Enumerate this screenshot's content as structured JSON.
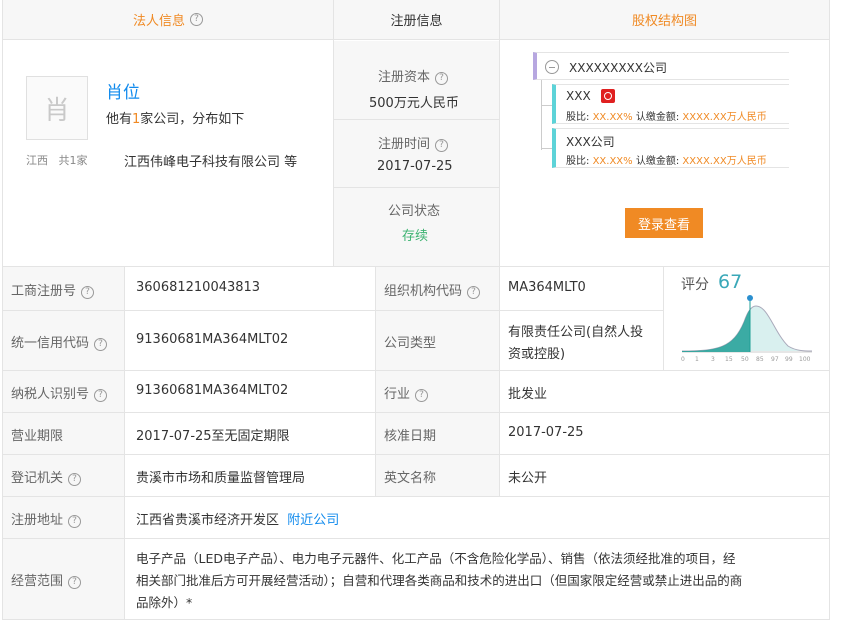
{
  "headers": {
    "legal": "法人信息",
    "reg": "注册信息",
    "equity": "股权结构图"
  },
  "person": {
    "avatar_char": "肖",
    "name": "肖位",
    "companies_prefix": "他有",
    "companies_count": "1",
    "companies_suffix": "家公司，分布如下",
    "region": "江西",
    "region_count": "共1家",
    "company": "江西伟峰电子科技有限公司 等"
  },
  "reg": {
    "capital_label": "注册资本",
    "capital_value": "500万元人民币",
    "date_label": "注册时间",
    "date_value": "2017-07-25",
    "status_label": "公司状态",
    "status_value": "存续"
  },
  "equity": {
    "root": "XXXXXXXXX公司",
    "nodes": [
      {
        "name": "XXX",
        "ratio_label": "股比:",
        "ratio": "XX.XX%",
        "sub_label": "认缴金额:",
        "sub": "XXXX.XX万人民币"
      },
      {
        "name": "XXX公司",
        "ratio_label": "股比:",
        "ratio": "XX.XX%",
        "sub_label": "认缴金额:",
        "sub": "XXXX.XX万人民币"
      }
    ],
    "login_button": "登录查看"
  },
  "score": {
    "label": "评分",
    "value": "67",
    "ticks": [
      "0",
      "1",
      "3",
      "15",
      "50",
      "85",
      "97",
      "99",
      "100"
    ]
  },
  "rows": [
    {
      "label1": "工商注册号",
      "value1": "360681210043813",
      "label2": "组织机构代码",
      "value2": "MA364MLT0"
    },
    {
      "label1": "统一信用代码",
      "value1": "91360681MA364MLT02",
      "label2": "公司类型",
      "value2_line1": "有限责任公司(自然人投",
      "value2_line2": "资或控股)"
    },
    {
      "label1": "纳税人识别号",
      "value1": "91360681MA364MLT02",
      "label2": "行业",
      "value2": "批发业"
    },
    {
      "label1": "营业期限",
      "value1": "2017-07-25至无固定期限",
      "label2": "核准日期",
      "value2": "2017-07-25"
    },
    {
      "label1": "登记机关",
      "value1": "贵溪市市场和质量监督管理局",
      "label2": "英文名称",
      "value2": "未公开"
    },
    {
      "label1": "注册地址",
      "value1": "江西省贵溪市经济开发区",
      "link": "附近公司"
    },
    {
      "label1": "经营范围",
      "line1": "电子产品（LED电子产品）、电力电子元器件、化工产品（不含危险化学品）、销售（依法须经批准的项目，经",
      "line2": "相关部门批准后方可开展经营活动）；自营和代理各类商品和技术的进出口（但国家限定经营或禁止进出品的商",
      "line3": "品除外）*"
    }
  ]
}
